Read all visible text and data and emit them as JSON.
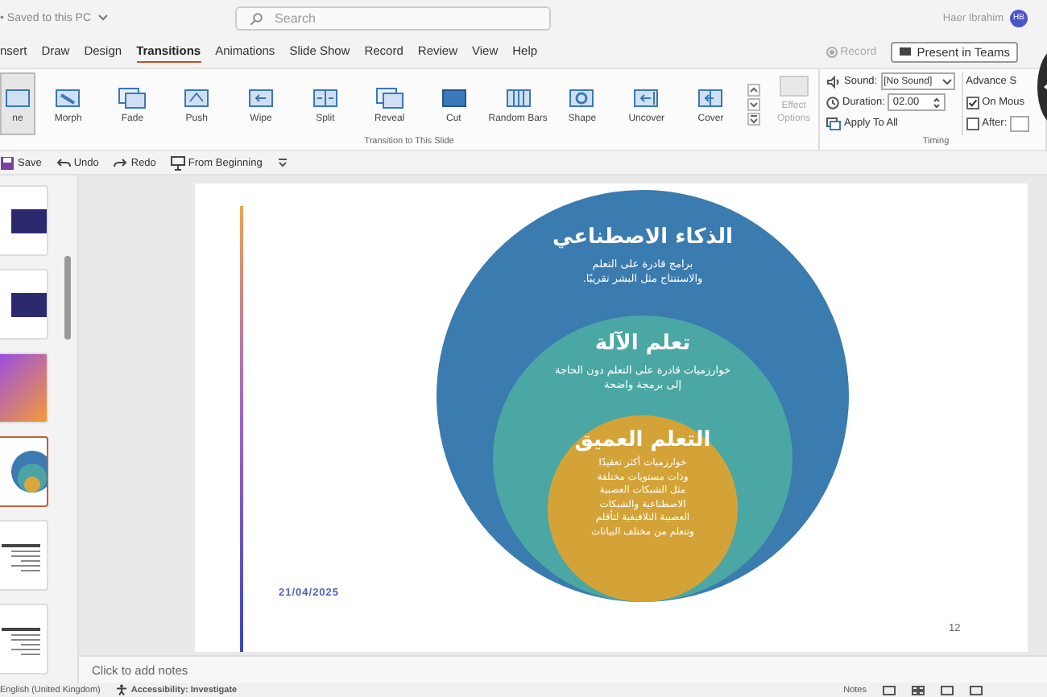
{
  "title_bar": {
    "save_status": "• Saved to this PC",
    "search": {
      "placeholder": "Search"
    },
    "user_name": "Haer Ibrahim",
    "avatar": "HB"
  },
  "tabs": [
    {
      "label": "nsert",
      "selected": false
    },
    {
      "label": "Draw",
      "selected": false
    },
    {
      "label": "Design",
      "selected": false
    },
    {
      "label": "Transitions",
      "selected": true
    },
    {
      "label": "Animations",
      "selected": false
    },
    {
      "label": "Slide Show",
      "selected": false
    },
    {
      "label": "Record",
      "selected": false
    },
    {
      "label": "Review",
      "selected": false
    },
    {
      "label": "View",
      "selected": false
    },
    {
      "label": "Help",
      "selected": false
    }
  ],
  "tab_actions": {
    "record": {
      "label": "Record",
      "disabled": true
    },
    "present": {
      "label": "Present in Teams"
    }
  },
  "ribbon": {
    "transitions": [
      {
        "label": "ne",
        "selected": true
      },
      {
        "label": "Morph",
        "selected": false
      },
      {
        "label": "Fade",
        "selected": false
      },
      {
        "label": "Push",
        "selected": false
      },
      {
        "label": "Wipe",
        "selected": false
      },
      {
        "label": "Split",
        "selected": false
      },
      {
        "label": "Reveal",
        "selected": false
      },
      {
        "label": "Cut",
        "selected": false
      },
      {
        "label": "Random Bars",
        "selected": false
      },
      {
        "label": "Shape",
        "selected": false
      },
      {
        "label": "Uncover",
        "selected": false
      },
      {
        "label": "Cover",
        "selected": false
      }
    ],
    "effect_options": {
      "label": "Effect Options",
      "disabled": true
    },
    "transition_group": "Transition to This Slide",
    "timing": {
      "sound": {
        "label": "Sound:",
        "value": "[No Sound]"
      },
      "duration": {
        "label": "Duration:",
        "value": "02.00"
      },
      "apply_all": "Apply To All",
      "advance": {
        "label": "Advance S",
        "on_mouse": {
          "label": "On Mous",
          "checked": true
        },
        "after": {
          "label": "After:",
          "checked": false
        }
      },
      "group": "Timing"
    }
  },
  "quick_access": [
    {
      "label": "Save",
      "kind": "save"
    },
    {
      "label": "Undo",
      "kind": "undo"
    },
    {
      "label": "Redo",
      "kind": "redo"
    },
    {
      "label": "From Beginning",
      "kind": "start"
    }
  ],
  "thumbnails": [
    {
      "kind": "image",
      "selected": false
    },
    {
      "kind": "image",
      "selected": false
    },
    {
      "kind": "gradient",
      "selected": false
    },
    {
      "kind": "diagram",
      "selected": true
    },
    {
      "kind": "text",
      "selected": false
    },
    {
      "kind": "text",
      "selected": false
    }
  ],
  "slide": {
    "circles": [
      {
        "title": "الذكاء الاصطناعي",
        "text": "برامج قادرة على التعلم والاستنتاج مثل البشر تقريبًا."
      },
      {
        "title": "تعلم الآلة",
        "text": "خوارزميات قادرة على التعلم دون الحاجة إلى برمجة واضحة"
      },
      {
        "title": "التعلم العميق",
        "text": "خوارزميات أكثر تعقيدًا وذات مستويات مختلفة مثل الشبكات العصبية الاصطناعية والشبكات العصبية التلافيفية لتأقلم وتتعلم من مختلف البيانات"
      }
    ],
    "date": "21/04/2025",
    "number": "12"
  },
  "notes": {
    "placeholder": "Click to add notes"
  },
  "status_bar": {
    "language": "English (United Kingdom)",
    "accessibility": "Accessibility: Investigate",
    "notes": "Notes"
  }
}
